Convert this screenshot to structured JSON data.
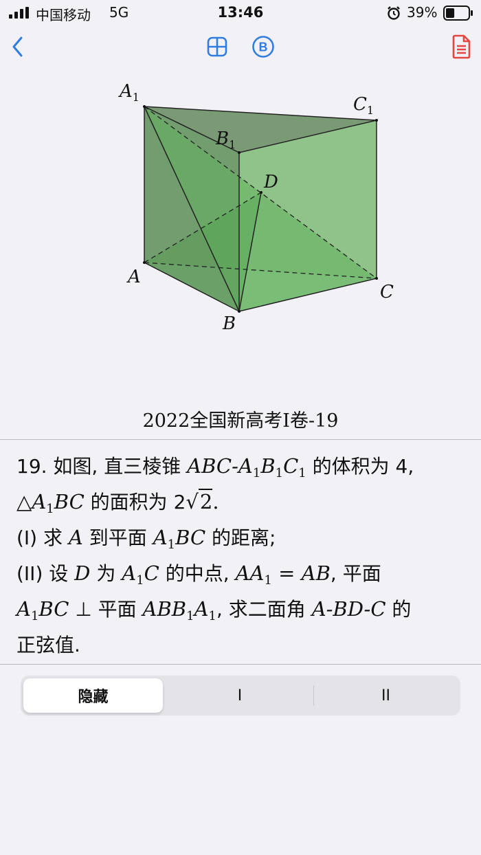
{
  "status": {
    "carrier": "中国移动",
    "network": "5G",
    "time": "13:46",
    "battery_percent": "39%",
    "battery_level": 0.39
  },
  "nav": {
    "back_icon": "chevron-left-icon",
    "grid_icon": "grid-icon",
    "b_icon_label": "B",
    "doc_icon": "document-icon",
    "accent_color": "#2f7de1",
    "doc_color": "#e5463f"
  },
  "figure": {
    "labels": {
      "A1": "A",
      "A1_sub": "1",
      "B1": "B",
      "B1_sub": "1",
      "C1": "C",
      "C1_sub": "1",
      "D": "D",
      "A": "A",
      "B": "B",
      "C": "C"
    },
    "caption": "2022全国新高考I卷-19"
  },
  "problem": {
    "line1_a": "19. 如图, 直三棱锥 ",
    "line1_m": "ABC-A",
    "line1_b": " 的体积为 4,",
    "line2_a": "△",
    "line2_b": " 的面积为 2",
    "line2_sqrt": "2",
    "line2_end": ".",
    "line3_a": "(I) 求 ",
    "line3_b": " 到平面 ",
    "line3_c": " 的距离;",
    "line4_a": "(II) 设 ",
    "line4_b": " 为 ",
    "line4_c": " 的中点, ",
    "line4_d": ", 平面",
    "line5_a": " ⊥ 平面 ",
    "line5_b": ", 求二面角 ",
    "line5_c": " 的",
    "line6": "正弦值."
  },
  "segmented": {
    "options": [
      "隐藏",
      "I",
      "II"
    ],
    "selected": "隐藏"
  }
}
